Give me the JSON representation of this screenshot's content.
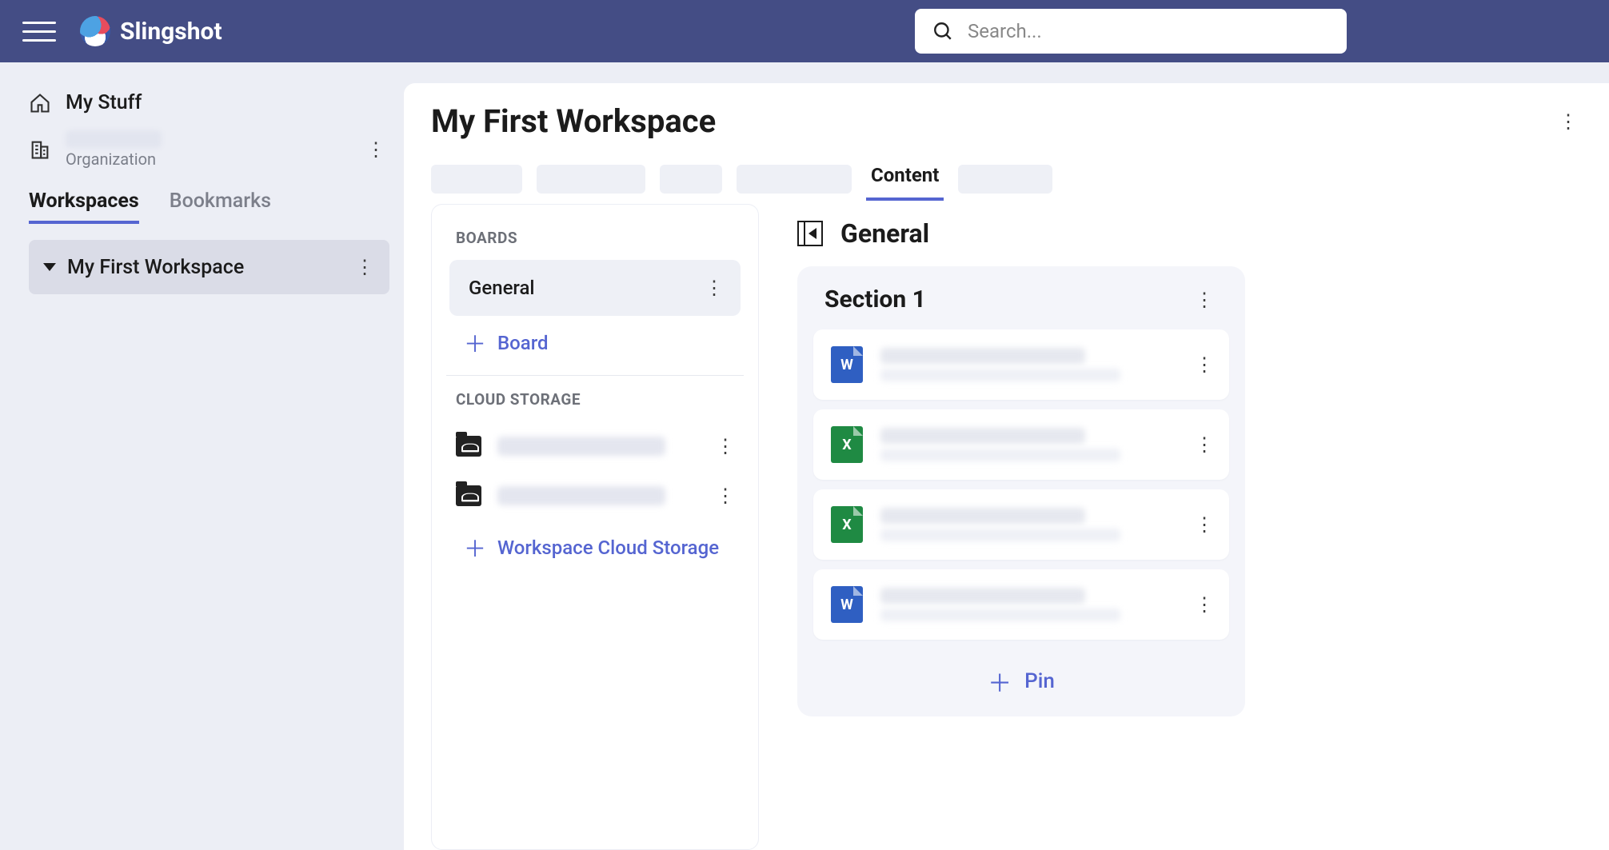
{
  "app": {
    "name": "Slingshot"
  },
  "search": {
    "placeholder": "Search..."
  },
  "sidebar": {
    "my_stuff": "My Stuff",
    "org_sub": "Organization",
    "tabs": {
      "workspaces": "Workspaces",
      "bookmarks": "Bookmarks"
    },
    "workspace_item": "My First Workspace"
  },
  "main": {
    "title": "My First Workspace",
    "active_tab": "Content"
  },
  "boards_panel": {
    "header": "BOARDS",
    "general": "General",
    "add_board": "Board",
    "cloud_header": "CLOUD STORAGE",
    "add_cloud": "Workspace Cloud Storage"
  },
  "board_content": {
    "title": "General",
    "section_title": "Section 1",
    "files": [
      {
        "type": "word"
      },
      {
        "type": "excel"
      },
      {
        "type": "excel"
      },
      {
        "type": "word"
      }
    ],
    "pin_label": "Pin"
  }
}
